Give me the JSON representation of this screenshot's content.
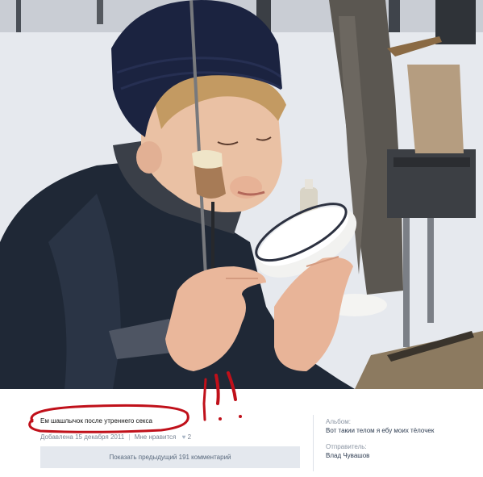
{
  "post": {
    "caption": "Ем шашлычок после утреннего секса",
    "added_date": "Добавлена 15 декабря 2011",
    "separator": "|",
    "like_label": "Мне нравится",
    "like_count": "2",
    "show_previous_comments": "Показать предыдущий 191 комментарий"
  },
  "sidebar": {
    "album_label": "Альбом:",
    "album_name": "Вот такии телом я ебу моих тёлочек",
    "sender_label": "Отправитель:",
    "sender_name": "Влад Чувашов"
  },
  "photo": {
    "subject": "boy in knit hat eating shashlik from a skewer next to a white bowl, snowy forest"
  },
  "colors": {
    "marker_red": "#c0101a",
    "button_bg": "#e4e8ee",
    "link_text": "#2b3a4f"
  }
}
